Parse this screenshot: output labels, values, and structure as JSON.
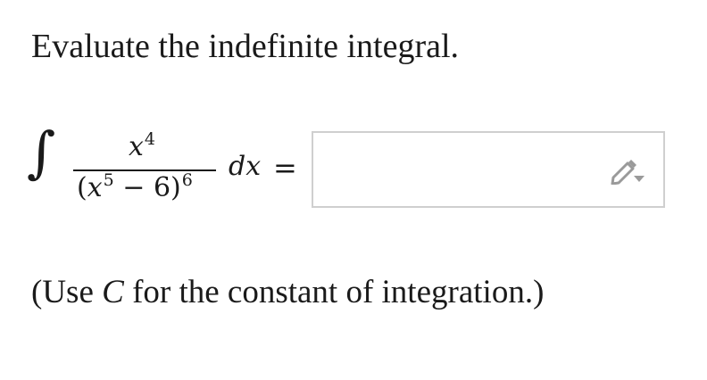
{
  "question": {
    "prompt": "Evaluate the indefinite integral."
  },
  "expression": {
    "integral_sign": "∫",
    "numerator_base": "x",
    "numerator_exponent": "4",
    "denominator_open": "(",
    "denominator_base": "x",
    "denominator_inner_exponent": "5",
    "denominator_rest": " − 6)",
    "denominator_outer_exponent": "6",
    "differential": "dx",
    "equals": "="
  },
  "answer": {
    "value": "",
    "icon": "pencil-icon"
  },
  "note": {
    "before": "(Use ",
    "variable": "C",
    "after": " for the constant of integration.)"
  },
  "colors": {
    "text": "#1a1a1a",
    "input_border": "#cfcfcf",
    "icon": "#9a9a9a"
  }
}
